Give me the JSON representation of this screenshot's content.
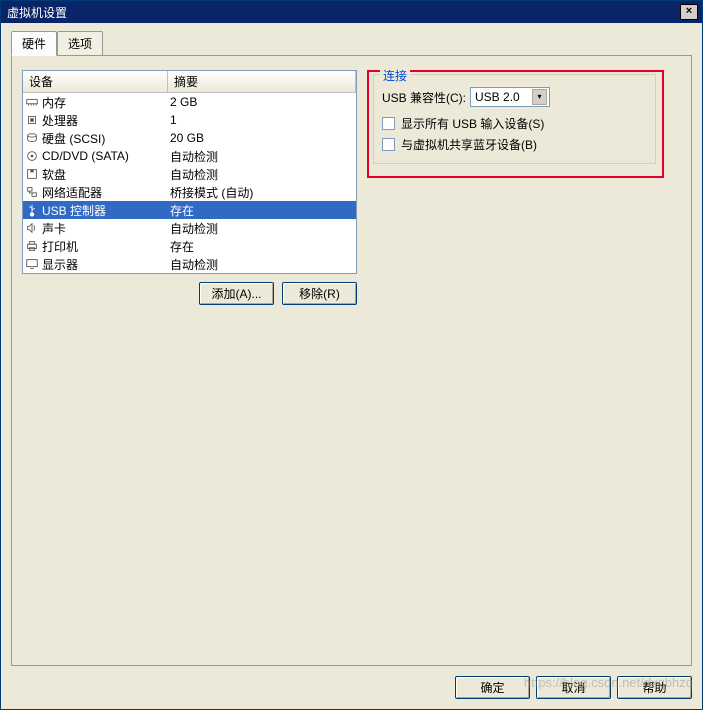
{
  "window": {
    "title": "虚拟机设置"
  },
  "tabs": {
    "hardware": "硬件",
    "options": "选项"
  },
  "list": {
    "header_device": "设备",
    "header_summary": "摘要",
    "rows": [
      {
        "device": "内存",
        "summary": "2 GB",
        "icon": "memory"
      },
      {
        "device": "处理器",
        "summary": "1",
        "icon": "cpu"
      },
      {
        "device": "硬盘 (SCSI)",
        "summary": "20 GB",
        "icon": "disk"
      },
      {
        "device": "CD/DVD (SATA)",
        "summary": "自动检测",
        "icon": "cd"
      },
      {
        "device": "软盘",
        "summary": "自动检测",
        "icon": "floppy"
      },
      {
        "device": "网络适配器",
        "summary": "桥接模式 (自动)",
        "icon": "network"
      },
      {
        "device": "USB 控制器",
        "summary": "存在",
        "icon": "usb"
      },
      {
        "device": "声卡",
        "summary": "自动检测",
        "icon": "sound"
      },
      {
        "device": "打印机",
        "summary": "存在",
        "icon": "printer"
      },
      {
        "device": "显示器",
        "summary": "自动检测",
        "icon": "display"
      }
    ],
    "selected_index": 6
  },
  "buttons": {
    "add": "添加(A)...",
    "remove": "移除(R)",
    "ok": "确定",
    "cancel": "取消",
    "help": "帮助"
  },
  "connection": {
    "group_title": "连接",
    "compat_label": "USB 兼容性(C):",
    "compat_value": "USB 2.0",
    "show_all_label": "显示所有 USB 输入设备(S)",
    "share_bt_label": "与虚拟机共享蓝牙设备(B)"
  },
  "watermark": "https://blog.csdn.net/dxqbhzq"
}
